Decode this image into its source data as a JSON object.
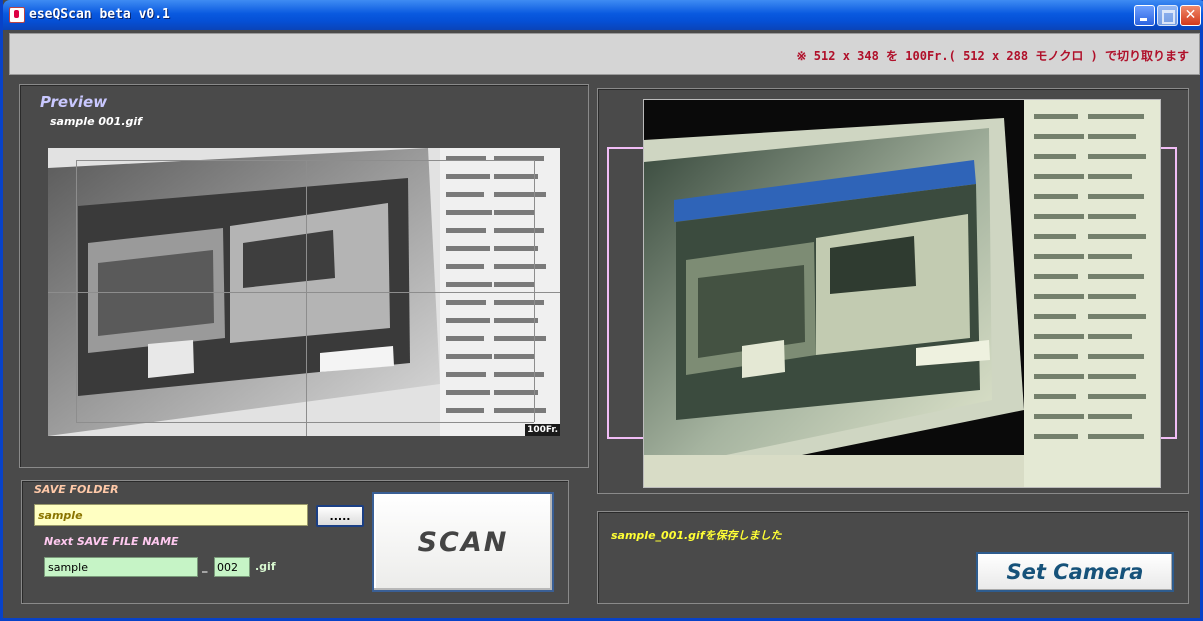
{
  "window": {
    "title": "eseQScan beta v0.1",
    "controls": [
      "minimize",
      "maximize",
      "close"
    ]
  },
  "info_bar": {
    "note": "※ 512 x 348 を 100Fr.( 512 x 288 モノクロ ) で切り取ります"
  },
  "preview": {
    "title": "Preview",
    "file_name": "sample 001.gif",
    "frame_label": "100Fr."
  },
  "save": {
    "folder_label": "SAVE FOLDER",
    "folder_value": "sample",
    "browse_label": ".....",
    "next_label": "Next SAVE FILE NAME",
    "name_value": "sample",
    "separator": "_",
    "number_value": "002",
    "extension": ".gif"
  },
  "scan_button": {
    "label": "SCAN"
  },
  "status": {
    "message": "sample_001.gifを保存しました"
  },
  "set_camera_button": {
    "label": "Set Camera"
  },
  "colors": {
    "note_text": "#b0102a",
    "preview_title": "#c9c8ff",
    "folder_field_bg": "#ffffc2",
    "name_field_bg": "#c6f4c6",
    "status_text": "#ffff35",
    "set_camera_text": "#16527a",
    "crop_bracket": "#f1bdf6"
  }
}
